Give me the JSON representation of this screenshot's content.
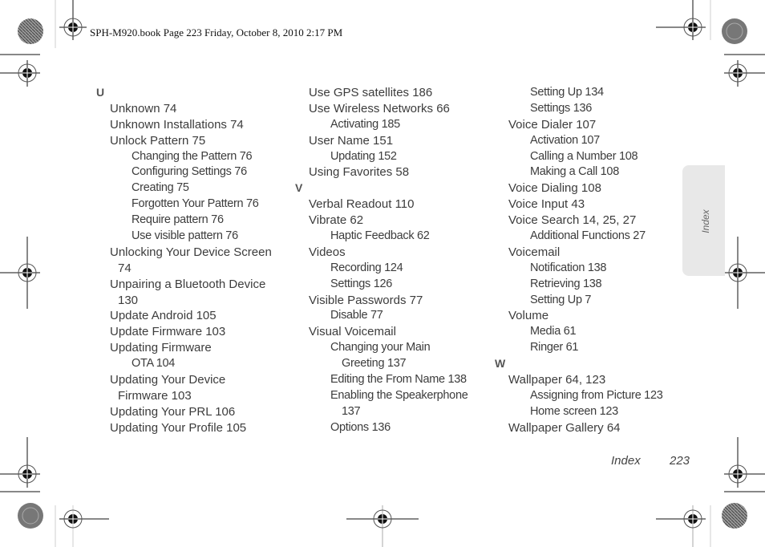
{
  "header": {
    "print_info": "SPH-M920.book  Page 223  Friday, October 8, 2010  2:17 PM"
  },
  "side_tab": {
    "label": "Index"
  },
  "footer": {
    "section": "Index",
    "page_number": "223"
  },
  "columns": [
    {
      "lines": [
        {
          "text": "U",
          "level": "letter"
        },
        {
          "text": "Unknown 74",
          "level": "l1"
        },
        {
          "text": "Unknown Installations 74",
          "level": "l1"
        },
        {
          "text": "Unlock Pattern 75",
          "level": "l1"
        },
        {
          "text": "Changing the Pattern 76",
          "level": "l2"
        },
        {
          "text": "Configuring Settings 76",
          "level": "l2"
        },
        {
          "text": "Creating 75",
          "level": "l2"
        },
        {
          "text": "Forgotten Your Pattern 76",
          "level": "l2"
        },
        {
          "text": "Require pattern 76",
          "level": "l2"
        },
        {
          "text": "Use visible pattern 76",
          "level": "l2"
        },
        {
          "text": "Unlocking Your Device Screen",
          "level": "l1"
        },
        {
          "text": "74",
          "level": "l1c"
        },
        {
          "text": "Unpairing a Bluetooth Device",
          "level": "l1"
        },
        {
          "text": "130",
          "level": "l1c"
        },
        {
          "text": "Update Android 105",
          "level": "l1"
        },
        {
          "text": "Update Firmware 103",
          "level": "l1"
        },
        {
          "text": "Updating Firmware",
          "level": "l1"
        },
        {
          "text": "OTA 104",
          "level": "l2"
        },
        {
          "text": "Updating Your Device",
          "level": "l1"
        },
        {
          "text": "Firmware 103",
          "level": "l1c"
        },
        {
          "text": "Updating Your PRL 106",
          "level": "l1"
        },
        {
          "text": "Updating Your Profile 105",
          "level": "l1"
        }
      ]
    },
    {
      "lines": [
        {
          "text": "Use GPS satellites 186",
          "level": "l1"
        },
        {
          "text": "Use Wireless Networks 66",
          "level": "l1"
        },
        {
          "text": "Activating 185",
          "level": "l2"
        },
        {
          "text": "User Name 151",
          "level": "l1"
        },
        {
          "text": "Updating 152",
          "level": "l2"
        },
        {
          "text": "Using Favorites 58",
          "level": "l1"
        },
        {
          "text": "V",
          "level": "letter"
        },
        {
          "text": "Verbal Readout 110",
          "level": "l1"
        },
        {
          "text": "Vibrate 62",
          "level": "l1"
        },
        {
          "text": "Haptic Feedback 62",
          "level": "l2"
        },
        {
          "text": "Videos",
          "level": "l1"
        },
        {
          "text": "Recording 124",
          "level": "l2"
        },
        {
          "text": "Settings 126",
          "level": "l2"
        },
        {
          "text": "Visible Passwords 77",
          "level": "l1"
        },
        {
          "text": "Disable 77",
          "level": "l2"
        },
        {
          "text": "Visual Voicemail",
          "level": "l1"
        },
        {
          "text": "Changing your Main",
          "level": "l2"
        },
        {
          "text": "Greeting 137",
          "level": "l2c"
        },
        {
          "text": "Editing the From Name 138",
          "level": "l2"
        },
        {
          "text": "Enabling the Speakerphone",
          "level": "l2"
        },
        {
          "text": "137",
          "level": "l2c"
        },
        {
          "text": "Options 136",
          "level": "l2"
        }
      ]
    },
    {
      "lines": [
        {
          "text": "Setting Up 134",
          "level": "l2"
        },
        {
          "text": "Settings 136",
          "level": "l2"
        },
        {
          "text": "Voice Dialer 107",
          "level": "l1"
        },
        {
          "text": "Activation 107",
          "level": "l2"
        },
        {
          "text": "Calling a Number 108",
          "level": "l2"
        },
        {
          "text": "Making a Call 108",
          "level": "l2"
        },
        {
          "text": "Voice Dialing 108",
          "level": "l1"
        },
        {
          "text": "Voice Input 43",
          "level": "l1"
        },
        {
          "text": "Voice Search 14, 25, 27",
          "level": "l1"
        },
        {
          "text": "Additional Functions 27",
          "level": "l2"
        },
        {
          "text": "Voicemail",
          "level": "l1"
        },
        {
          "text": "Notification 138",
          "level": "l2"
        },
        {
          "text": "Retrieving 138",
          "level": "l2"
        },
        {
          "text": "Setting Up 7",
          "level": "l2"
        },
        {
          "text": "Volume",
          "level": "l1"
        },
        {
          "text": "Media 61",
          "level": "l2"
        },
        {
          "text": "Ringer 61",
          "level": "l2"
        },
        {
          "text": "W",
          "level": "letter"
        },
        {
          "text": "Wallpaper 64, 123",
          "level": "l1"
        },
        {
          "text": "Assigning from Picture 123",
          "level": "l2"
        },
        {
          "text": "Home screen 123",
          "level": "l2"
        },
        {
          "text": "Wallpaper Gallery 64",
          "level": "l1"
        }
      ]
    }
  ]
}
